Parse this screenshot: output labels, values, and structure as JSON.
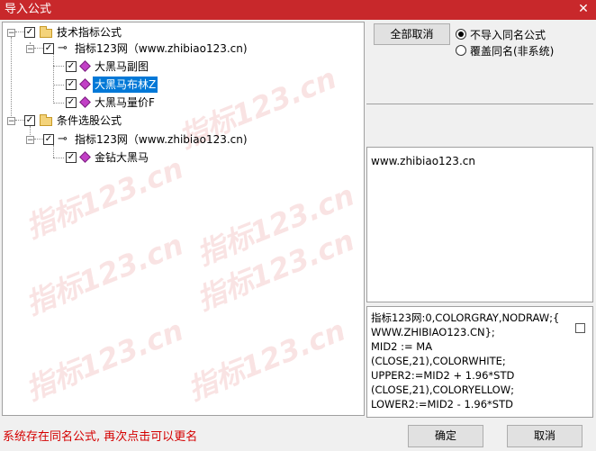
{
  "window": {
    "title": "导入公式"
  },
  "watermark_text": "指标123.cn",
  "tree": {
    "items": [
      {
        "label": "技术指标公式",
        "checked": true,
        "expanded": true,
        "icon": "folder-icon"
      },
      {
        "label": "指标123网（www.zhibiao123.cn)",
        "checked": true,
        "expanded": true,
        "icon": "key-icon"
      },
      {
        "label": "大黑马副图",
        "checked": true,
        "icon": "formula-gem-icon"
      },
      {
        "label": "大黑马布林Z",
        "checked": true,
        "icon": "formula-gem-icon",
        "selected": true
      },
      {
        "label": "大黑马量价F",
        "checked": true,
        "icon": "formula-gem-icon"
      },
      {
        "label": "条件选股公式",
        "checked": true,
        "expanded": true,
        "icon": "folder-icon"
      },
      {
        "label": "指标123网（www.zhibiao123.cn)",
        "checked": true,
        "expanded": true,
        "icon": "key-icon"
      },
      {
        "label": "金钻大黑马",
        "checked": true,
        "icon": "formula-gem-icon"
      }
    ]
  },
  "buttons": {
    "cancel_all": "全部取消",
    "ok": "确定",
    "cancel": "取消"
  },
  "options": [
    {
      "label": "不导入同名公式",
      "selected": true
    },
    {
      "label": "覆盖同名(非系统)",
      "selected": false
    }
  ],
  "info_text": "www.zhibiao123.cn",
  "code_text": "指标123网:0,COLORGRAY,NODRAW;{\nWWW.ZHIBIAO123.CN};\nMID2 := MA\n(CLOSE,21),COLORWHITE;\nUPPER2:=MID2 + 1.96*STD\n(CLOSE,21),COLORYELLOW;\nLOWER2:=MID2 - 1.96*STD",
  "status_text": "系统存在同名公式, 再次点击可以更名"
}
